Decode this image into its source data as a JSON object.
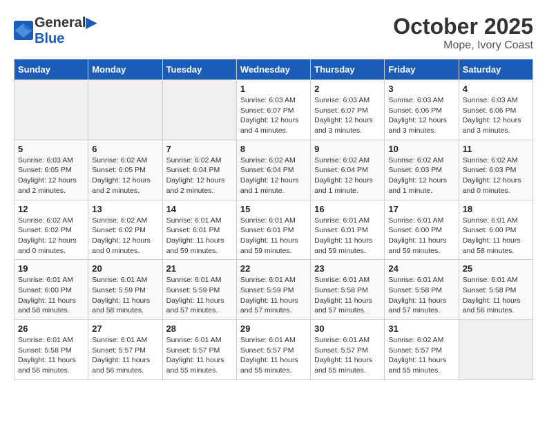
{
  "logo": {
    "line1": "General",
    "line2": "Blue"
  },
  "title": "October 2025",
  "location": "Mope, Ivory Coast",
  "days_of_week": [
    "Sunday",
    "Monday",
    "Tuesday",
    "Wednesday",
    "Thursday",
    "Friday",
    "Saturday"
  ],
  "weeks": [
    [
      {
        "day": "",
        "info": ""
      },
      {
        "day": "",
        "info": ""
      },
      {
        "day": "",
        "info": ""
      },
      {
        "day": "1",
        "info": "Sunrise: 6:03 AM\nSunset: 6:07 PM\nDaylight: 12 hours\nand 4 minutes."
      },
      {
        "day": "2",
        "info": "Sunrise: 6:03 AM\nSunset: 6:07 PM\nDaylight: 12 hours\nand 3 minutes."
      },
      {
        "day": "3",
        "info": "Sunrise: 6:03 AM\nSunset: 6:06 PM\nDaylight: 12 hours\nand 3 minutes."
      },
      {
        "day": "4",
        "info": "Sunrise: 6:03 AM\nSunset: 6:06 PM\nDaylight: 12 hours\nand 3 minutes."
      }
    ],
    [
      {
        "day": "5",
        "info": "Sunrise: 6:03 AM\nSunset: 6:05 PM\nDaylight: 12 hours\nand 2 minutes."
      },
      {
        "day": "6",
        "info": "Sunrise: 6:02 AM\nSunset: 6:05 PM\nDaylight: 12 hours\nand 2 minutes."
      },
      {
        "day": "7",
        "info": "Sunrise: 6:02 AM\nSunset: 6:04 PM\nDaylight: 12 hours\nand 2 minutes."
      },
      {
        "day": "8",
        "info": "Sunrise: 6:02 AM\nSunset: 6:04 PM\nDaylight: 12 hours\nand 1 minute."
      },
      {
        "day": "9",
        "info": "Sunrise: 6:02 AM\nSunset: 6:04 PM\nDaylight: 12 hours\nand 1 minute."
      },
      {
        "day": "10",
        "info": "Sunrise: 6:02 AM\nSunset: 6:03 PM\nDaylight: 12 hours\nand 1 minute."
      },
      {
        "day": "11",
        "info": "Sunrise: 6:02 AM\nSunset: 6:03 PM\nDaylight: 12 hours\nand 0 minutes."
      }
    ],
    [
      {
        "day": "12",
        "info": "Sunrise: 6:02 AM\nSunset: 6:02 PM\nDaylight: 12 hours\nand 0 minutes."
      },
      {
        "day": "13",
        "info": "Sunrise: 6:02 AM\nSunset: 6:02 PM\nDaylight: 12 hours\nand 0 minutes."
      },
      {
        "day": "14",
        "info": "Sunrise: 6:01 AM\nSunset: 6:01 PM\nDaylight: 11 hours\nand 59 minutes."
      },
      {
        "day": "15",
        "info": "Sunrise: 6:01 AM\nSunset: 6:01 PM\nDaylight: 11 hours\nand 59 minutes."
      },
      {
        "day": "16",
        "info": "Sunrise: 6:01 AM\nSunset: 6:01 PM\nDaylight: 11 hours\nand 59 minutes."
      },
      {
        "day": "17",
        "info": "Sunrise: 6:01 AM\nSunset: 6:00 PM\nDaylight: 11 hours\nand 59 minutes."
      },
      {
        "day": "18",
        "info": "Sunrise: 6:01 AM\nSunset: 6:00 PM\nDaylight: 11 hours\nand 58 minutes."
      }
    ],
    [
      {
        "day": "19",
        "info": "Sunrise: 6:01 AM\nSunset: 6:00 PM\nDaylight: 11 hours\nand 58 minutes."
      },
      {
        "day": "20",
        "info": "Sunrise: 6:01 AM\nSunset: 5:59 PM\nDaylight: 11 hours\nand 58 minutes."
      },
      {
        "day": "21",
        "info": "Sunrise: 6:01 AM\nSunset: 5:59 PM\nDaylight: 11 hours\nand 57 minutes."
      },
      {
        "day": "22",
        "info": "Sunrise: 6:01 AM\nSunset: 5:59 PM\nDaylight: 11 hours\nand 57 minutes."
      },
      {
        "day": "23",
        "info": "Sunrise: 6:01 AM\nSunset: 5:58 PM\nDaylight: 11 hours\nand 57 minutes."
      },
      {
        "day": "24",
        "info": "Sunrise: 6:01 AM\nSunset: 5:58 PM\nDaylight: 11 hours\nand 57 minutes."
      },
      {
        "day": "25",
        "info": "Sunrise: 6:01 AM\nSunset: 5:58 PM\nDaylight: 11 hours\nand 56 minutes."
      }
    ],
    [
      {
        "day": "26",
        "info": "Sunrise: 6:01 AM\nSunset: 5:58 PM\nDaylight: 11 hours\nand 56 minutes."
      },
      {
        "day": "27",
        "info": "Sunrise: 6:01 AM\nSunset: 5:57 PM\nDaylight: 11 hours\nand 56 minutes."
      },
      {
        "day": "28",
        "info": "Sunrise: 6:01 AM\nSunset: 5:57 PM\nDaylight: 11 hours\nand 55 minutes."
      },
      {
        "day": "29",
        "info": "Sunrise: 6:01 AM\nSunset: 5:57 PM\nDaylight: 11 hours\nand 55 minutes."
      },
      {
        "day": "30",
        "info": "Sunrise: 6:01 AM\nSunset: 5:57 PM\nDaylight: 11 hours\nand 55 minutes."
      },
      {
        "day": "31",
        "info": "Sunrise: 6:02 AM\nSunset: 5:57 PM\nDaylight: 11 hours\nand 55 minutes."
      },
      {
        "day": "",
        "info": ""
      }
    ]
  ]
}
